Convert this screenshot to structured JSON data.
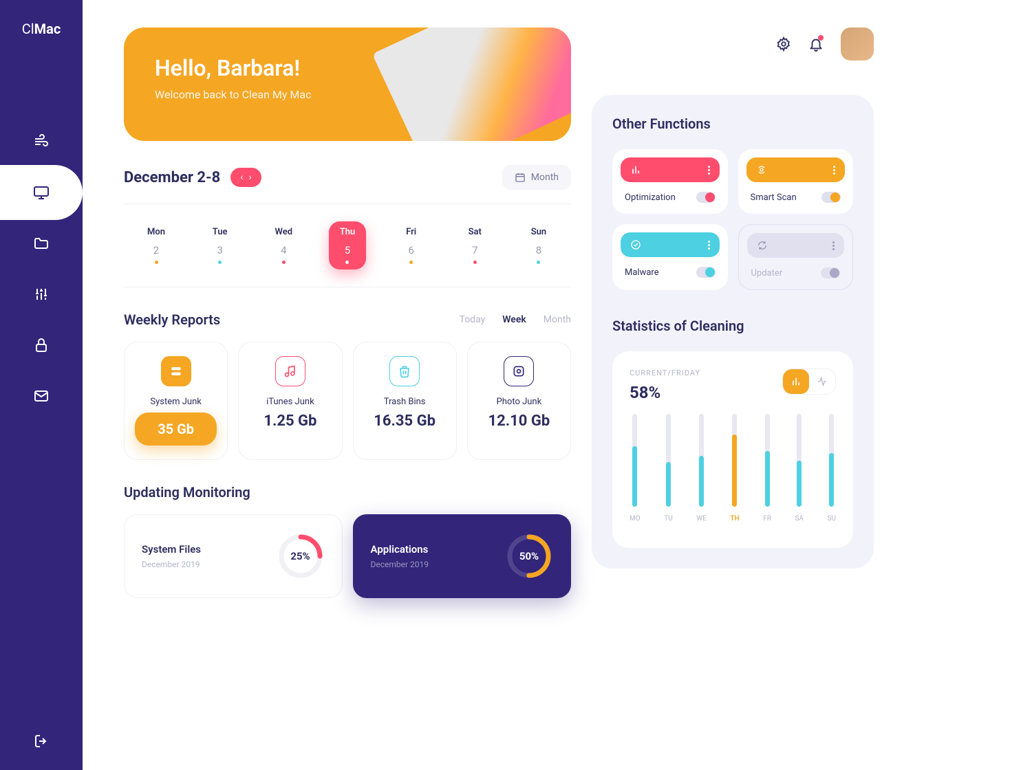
{
  "logo": {
    "prefix": "Cl",
    "suffix": "Mac"
  },
  "hero": {
    "title": "Hello, Barbara!",
    "subtitle": "Welcome back to Clean My Mac"
  },
  "date_range": "December 2-8",
  "month_label": "Month",
  "week": [
    {
      "name": "Mon",
      "num": "2",
      "dot": "#f5a623",
      "active": false
    },
    {
      "name": "Tue",
      "num": "3",
      "dot": "#4dd0e1",
      "active": false
    },
    {
      "name": "Wed",
      "num": "4",
      "dot": "#ff4d6d",
      "active": false
    },
    {
      "name": "Thu",
      "num": "5",
      "dot": "#ffffff",
      "active": true
    },
    {
      "name": "Fri",
      "num": "6",
      "dot": "#f5a623",
      "active": false
    },
    {
      "name": "Sat",
      "num": "7",
      "dot": "#ff4d6d",
      "active": false
    },
    {
      "name": "Sun",
      "num": "8",
      "dot": "#4dd0e1",
      "active": false
    }
  ],
  "reports_title": "Weekly Reports",
  "filters": {
    "today": "Today",
    "week": "Week",
    "month": "Month"
  },
  "reports": [
    {
      "label": "System Junk",
      "value": "35 Gb",
      "color": "#f5a623",
      "pill": true
    },
    {
      "label": "iTunes Junk",
      "value": "1.25 Gb",
      "color": "#ff4d6d",
      "pill": false
    },
    {
      "label": "Trash Bins",
      "value": "16.35 Gb",
      "color": "#4dd0e1",
      "pill": false
    },
    {
      "label": "Photo Junk",
      "value": "12.10 Gb",
      "color": "#32257a",
      "pill": false
    }
  ],
  "monitoring_title": "Updating Monitoring",
  "monitors": [
    {
      "title": "System Files",
      "date": "December 2019",
      "pct": "25%",
      "pct_num": 25,
      "color": "#ff4d6d",
      "dark": false
    },
    {
      "title": "Applications",
      "date": "December 2019",
      "pct": "50%",
      "pct_num": 50,
      "color": "#f5a623",
      "dark": true
    }
  ],
  "functions_title": "Other Functions",
  "functions": [
    {
      "label": "Optimization",
      "color": "#ff4d6d",
      "toggle_color": "#ff4d6d",
      "disabled": false
    },
    {
      "label": "Smart Scan",
      "color": "#f5a623",
      "toggle_color": "#f5a623",
      "disabled": false
    },
    {
      "label": "Malware",
      "color": "#4dd0e1",
      "toggle_color": "#4dd0e1",
      "disabled": false
    },
    {
      "label": "Updater",
      "color": "#e0e0ef",
      "toggle_color": "#aaa7c7",
      "disabled": true
    }
  ],
  "stats_title": "Statistics of Cleaning",
  "stats_sub": "CURRENT/FRIDAY",
  "stats_val": "58%",
  "chart_data": {
    "type": "bar",
    "categories": [
      "MO",
      "TU",
      "WE",
      "TH",
      "FR",
      "SA",
      "SU"
    ],
    "values": [
      65,
      48,
      55,
      78,
      60,
      50,
      58
    ],
    "highlight_index": 3,
    "bar_color": "#4dd0e1",
    "highlight_color": "#f5a623",
    "ylim": [
      0,
      100
    ]
  },
  "colors": {
    "purple": "#32257a",
    "orange": "#f5a623",
    "red": "#ff4d6d",
    "cyan": "#4dd0e1"
  }
}
